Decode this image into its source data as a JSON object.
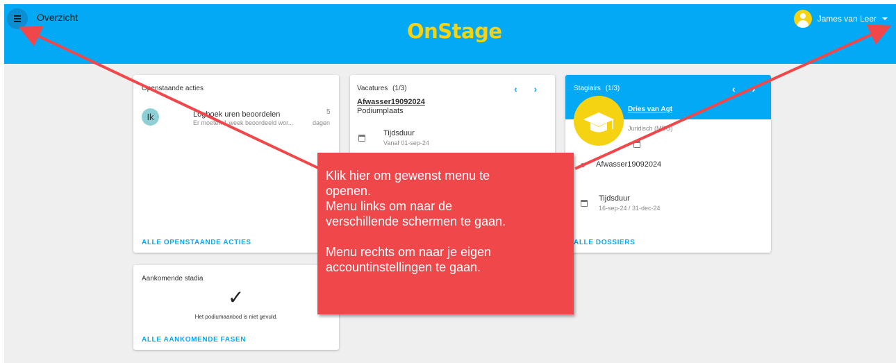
{
  "header": {
    "menu_icon": "hamburger-menu-icon",
    "title": "Overzicht",
    "logo": "OnStage",
    "user_name": "James van Leer",
    "brand_color": "#03a9f4",
    "logo_color": "#f5d312"
  },
  "open_actions": {
    "title": "Openstaande acties",
    "avatar_initials": "Ik",
    "item_title": "Logboek uren beoordelen",
    "item_subtitle": "Er moeten 1 week beoordeeld wor...",
    "item_count": "5",
    "item_unit": "dagen",
    "footer": "ALLE OPENSTAANDE ACTIES"
  },
  "upcoming": {
    "title": "Aankomende stadia",
    "message": "Het podiumaanbod is niet gevuld.",
    "footer": "ALLE AANKOMENDE FASEN"
  },
  "vacatures": {
    "title": "Vacatures",
    "counter": "(1/3)",
    "name": "Afwasser19092024",
    "place": "Podiumplaats",
    "duration_label": "Tijdsduur",
    "duration_value": "Vanaf 01-sep-24"
  },
  "stagiairs": {
    "title": "Stagiairs",
    "counter": "(1/3)",
    "student_name": "Dries van Agt",
    "school": "Juridisch (MBO)",
    "vacature": "Afwasser19092024",
    "duration_label": "Tijdsduur",
    "duration_value": "16-sep-24 / 31-dec-24",
    "footer": "ALLE DOSSIERS"
  },
  "callout": {
    "line1": "Klik hier om gewenst menu te",
    "line2": "openen.",
    "line3": "Menu links om naar de",
    "line4": "verschillende schermen te gaan.",
    "line5": "Menu rechts om naar je eigen",
    "line6": "accountinstellingen te gaan.",
    "color": "#f0474b"
  }
}
